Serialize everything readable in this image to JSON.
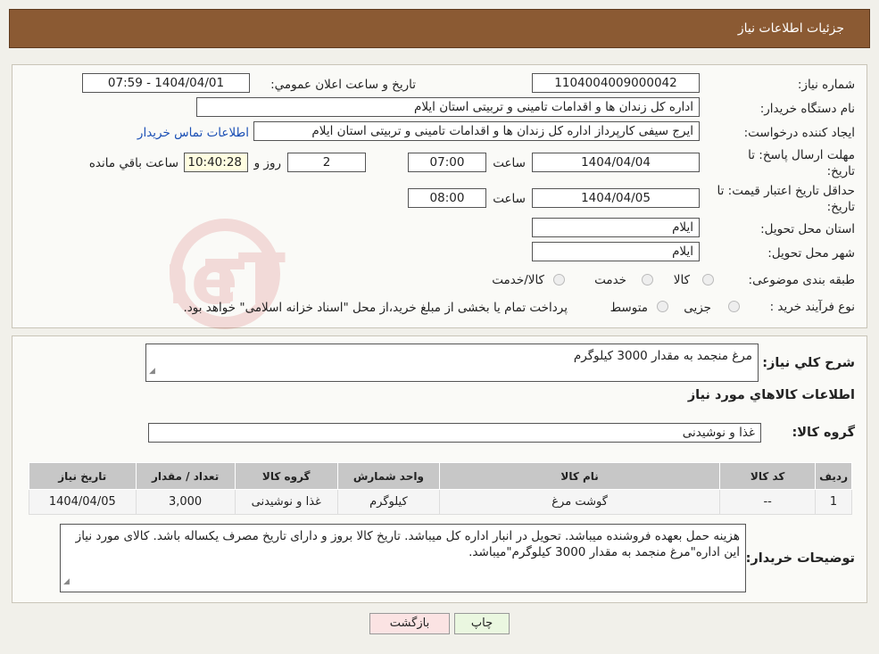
{
  "header": {
    "title": "جزئیات اطلاعات نیاز"
  },
  "fields": {
    "need_number_label": "شماره نیاز:",
    "need_number": "1104004009000042",
    "announce_label": "تاریخ و ساعت اعلان عمومي:",
    "announce_value": "1404/04/01 - 07:59",
    "buyer_org_label": "نام دستگاه خریدار:",
    "buyer_org": "اداره کل زندان ها و اقدامات تامینی و تربیتی استان ایلام",
    "creator_label": "ایجاد کننده درخواست:",
    "creator": "ایرج  سیفی کارپرداز اداره کل زندان ها و اقدامات تامینی و تربیتی استان ایلام",
    "contact_link": "اطلاعات تماس خریدار",
    "deadline_label_1": "مهلت ارسال پاسخ: تا",
    "deadline_label_2": "تاریخ:",
    "deadline_date": "1404/04/04",
    "time_label": "ساعت",
    "deadline_time": "07:00",
    "days_value": "2",
    "days_label": "روز و",
    "remaining_time": "10:40:28",
    "remaining_label": "ساعت باقي مانده",
    "validity_label_1": "حداقل تاریخ اعتبار قیمت: تا",
    "validity_label_2": "تاریخ:",
    "validity_date": "1404/04/05",
    "validity_time": "08:00",
    "province_label": "استان محل تحویل:",
    "province": "ایلام",
    "city_label": "شهر محل تحویل:",
    "city": "ایلام",
    "category_label": "طبقه بندی موضوعی:",
    "category_options": [
      "کالا",
      "خدمت",
      "کالا/خدمت"
    ],
    "process_label": "نوع فرآیند خرید :",
    "process_options": [
      "جزیی",
      "متوسط"
    ],
    "process_note": "پرداخت تمام یا بخشی از مبلغ خرید،از محل \"اسناد خزانه اسلامی\" خواهد بود."
  },
  "summary": {
    "desc_label": "شرح کلي نياز:",
    "desc_value": "مرغ منجمد به مقدار  3000 کیلوگرم",
    "goods_info_title": "اطلاعات کالاهاي مورد نياز",
    "group_label": "گروه کالا:",
    "group_value": "غذا و نوشیدنی"
  },
  "table": {
    "headers": [
      "ردیف",
      "کد کالا",
      "نام کالا",
      "واحد شمارش",
      "گروه کالا",
      "تعداد / مقدار",
      "تاریخ نیاز"
    ],
    "rows": [
      [
        "1",
        "--",
        "گوشت مرغ",
        "کیلوگرم",
        "غذا و نوشیدنی",
        "3,000",
        "1404/04/05"
      ]
    ]
  },
  "buyer_notes": {
    "label": "توضیحات خریدار:",
    "text": "هزینه حمل بعهده فروشنده میباشد. تحویل در انبار اداره کل میباشد. تاریخ کالا بروز و دارای تاریخ مصرف یکساله باشد. کالای مورد نیاز این اداره\"مرغ منجمد به مقدار  3000 کیلوگرم\"میباشد."
  },
  "buttons": {
    "print": "چاپ",
    "back": "بازگشت"
  },
  "watermark": {
    "text": "AriaTender.neT"
  }
}
